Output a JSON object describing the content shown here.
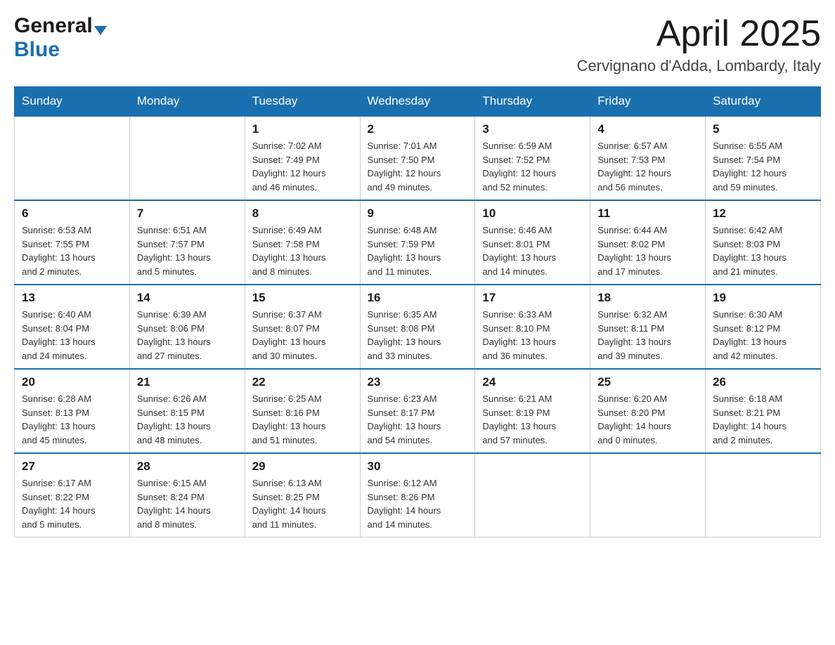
{
  "header": {
    "logo_general": "General",
    "logo_blue": "Blue",
    "month_title": "April 2025",
    "location": "Cervignano d'Adda, Lombardy, Italy"
  },
  "days_of_week": [
    "Sunday",
    "Monday",
    "Tuesday",
    "Wednesday",
    "Thursday",
    "Friday",
    "Saturday"
  ],
  "weeks": [
    [
      {
        "day": "",
        "info": ""
      },
      {
        "day": "",
        "info": ""
      },
      {
        "day": "1",
        "info": "Sunrise: 7:02 AM\nSunset: 7:49 PM\nDaylight: 12 hours\nand 46 minutes."
      },
      {
        "day": "2",
        "info": "Sunrise: 7:01 AM\nSunset: 7:50 PM\nDaylight: 12 hours\nand 49 minutes."
      },
      {
        "day": "3",
        "info": "Sunrise: 6:59 AM\nSunset: 7:52 PM\nDaylight: 12 hours\nand 52 minutes."
      },
      {
        "day": "4",
        "info": "Sunrise: 6:57 AM\nSunset: 7:53 PM\nDaylight: 12 hours\nand 56 minutes."
      },
      {
        "day": "5",
        "info": "Sunrise: 6:55 AM\nSunset: 7:54 PM\nDaylight: 12 hours\nand 59 minutes."
      }
    ],
    [
      {
        "day": "6",
        "info": "Sunrise: 6:53 AM\nSunset: 7:55 PM\nDaylight: 13 hours\nand 2 minutes."
      },
      {
        "day": "7",
        "info": "Sunrise: 6:51 AM\nSunset: 7:57 PM\nDaylight: 13 hours\nand 5 minutes."
      },
      {
        "day": "8",
        "info": "Sunrise: 6:49 AM\nSunset: 7:58 PM\nDaylight: 13 hours\nand 8 minutes."
      },
      {
        "day": "9",
        "info": "Sunrise: 6:48 AM\nSunset: 7:59 PM\nDaylight: 13 hours\nand 11 minutes."
      },
      {
        "day": "10",
        "info": "Sunrise: 6:46 AM\nSunset: 8:01 PM\nDaylight: 13 hours\nand 14 minutes."
      },
      {
        "day": "11",
        "info": "Sunrise: 6:44 AM\nSunset: 8:02 PM\nDaylight: 13 hours\nand 17 minutes."
      },
      {
        "day": "12",
        "info": "Sunrise: 6:42 AM\nSunset: 8:03 PM\nDaylight: 13 hours\nand 21 minutes."
      }
    ],
    [
      {
        "day": "13",
        "info": "Sunrise: 6:40 AM\nSunset: 8:04 PM\nDaylight: 13 hours\nand 24 minutes."
      },
      {
        "day": "14",
        "info": "Sunrise: 6:39 AM\nSunset: 8:06 PM\nDaylight: 13 hours\nand 27 minutes."
      },
      {
        "day": "15",
        "info": "Sunrise: 6:37 AM\nSunset: 8:07 PM\nDaylight: 13 hours\nand 30 minutes."
      },
      {
        "day": "16",
        "info": "Sunrise: 6:35 AM\nSunset: 8:08 PM\nDaylight: 13 hours\nand 33 minutes."
      },
      {
        "day": "17",
        "info": "Sunrise: 6:33 AM\nSunset: 8:10 PM\nDaylight: 13 hours\nand 36 minutes."
      },
      {
        "day": "18",
        "info": "Sunrise: 6:32 AM\nSunset: 8:11 PM\nDaylight: 13 hours\nand 39 minutes."
      },
      {
        "day": "19",
        "info": "Sunrise: 6:30 AM\nSunset: 8:12 PM\nDaylight: 13 hours\nand 42 minutes."
      }
    ],
    [
      {
        "day": "20",
        "info": "Sunrise: 6:28 AM\nSunset: 8:13 PM\nDaylight: 13 hours\nand 45 minutes."
      },
      {
        "day": "21",
        "info": "Sunrise: 6:26 AM\nSunset: 8:15 PM\nDaylight: 13 hours\nand 48 minutes."
      },
      {
        "day": "22",
        "info": "Sunrise: 6:25 AM\nSunset: 8:16 PM\nDaylight: 13 hours\nand 51 minutes."
      },
      {
        "day": "23",
        "info": "Sunrise: 6:23 AM\nSunset: 8:17 PM\nDaylight: 13 hours\nand 54 minutes."
      },
      {
        "day": "24",
        "info": "Sunrise: 6:21 AM\nSunset: 8:19 PM\nDaylight: 13 hours\nand 57 minutes."
      },
      {
        "day": "25",
        "info": "Sunrise: 6:20 AM\nSunset: 8:20 PM\nDaylight: 14 hours\nand 0 minutes."
      },
      {
        "day": "26",
        "info": "Sunrise: 6:18 AM\nSunset: 8:21 PM\nDaylight: 14 hours\nand 2 minutes."
      }
    ],
    [
      {
        "day": "27",
        "info": "Sunrise: 6:17 AM\nSunset: 8:22 PM\nDaylight: 14 hours\nand 5 minutes."
      },
      {
        "day": "28",
        "info": "Sunrise: 6:15 AM\nSunset: 8:24 PM\nDaylight: 14 hours\nand 8 minutes."
      },
      {
        "day": "29",
        "info": "Sunrise: 6:13 AM\nSunset: 8:25 PM\nDaylight: 14 hours\nand 11 minutes."
      },
      {
        "day": "30",
        "info": "Sunrise: 6:12 AM\nSunset: 8:26 PM\nDaylight: 14 hours\nand 14 minutes."
      },
      {
        "day": "",
        "info": ""
      },
      {
        "day": "",
        "info": ""
      },
      {
        "day": "",
        "info": ""
      }
    ]
  ]
}
